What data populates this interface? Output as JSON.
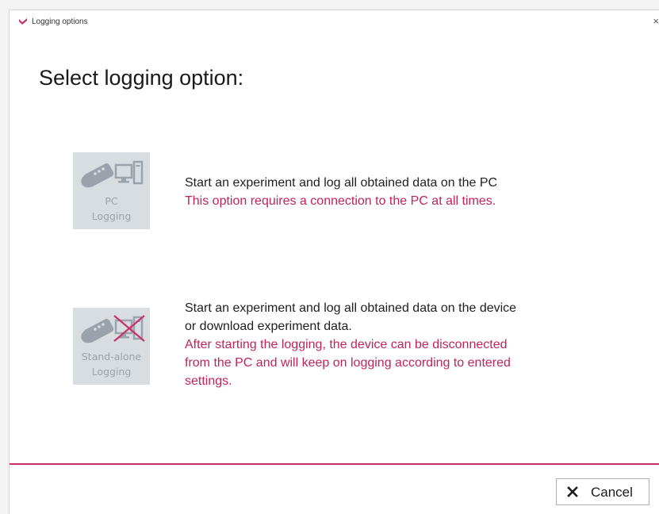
{
  "window": {
    "title": "Logging options",
    "close_glyph": "×"
  },
  "heading": "Select logging option:",
  "options": [
    {
      "tile_label_1": "PC",
      "tile_label_2": "Logging",
      "icon": "device-to-pc-icon",
      "lines": [
        "Start an experiment and log all obtained data on the PC"
      ],
      "warning_lines": [
        "This option requires a connection to the PC at all times."
      ]
    },
    {
      "tile_label_1": "Stand-alone",
      "tile_label_2": "Logging",
      "icon": "device-standalone-icon",
      "lines": [
        "Start an experiment and log all obtained data on the device",
        "or download experiment data."
      ],
      "warning_lines": [
        "After starting the logging, the device can be disconnected",
        "from the PC and will keep on logging according to entered",
        "settings."
      ]
    }
  ],
  "footer": {
    "cancel_label": "Cancel",
    "cancel_icon": "close-x-icon"
  },
  "colors": {
    "accent": "#c8326a",
    "warning_text": "#c0245a",
    "tile_bg": "#d8dde2",
    "tile_fg": "#9aa3ab"
  }
}
